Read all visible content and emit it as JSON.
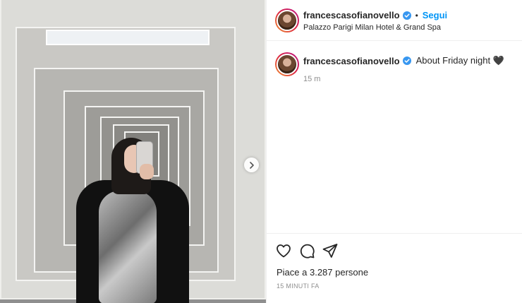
{
  "post": {
    "username": "francescasofianovello",
    "follow_label": "Segui",
    "separator": "•",
    "location": "Palazzo Parigi Milan Hotel & Grand Spa",
    "caption": {
      "username": "francescasofianovello",
      "text": "About Friday night 🖤",
      "time": "15 m"
    },
    "likes_label": "Piace a 3.287 persone",
    "age_label": "15 MINUTI FA"
  },
  "icons": {
    "verified": "verified-badge-icon",
    "next": "chevron-right-icon",
    "like": "heart-icon",
    "comment": "comment-icon",
    "share": "paper-plane-icon"
  },
  "colors": {
    "accent": "#0095f6",
    "secondary_text": "#8e8e8e",
    "text": "#262626"
  }
}
